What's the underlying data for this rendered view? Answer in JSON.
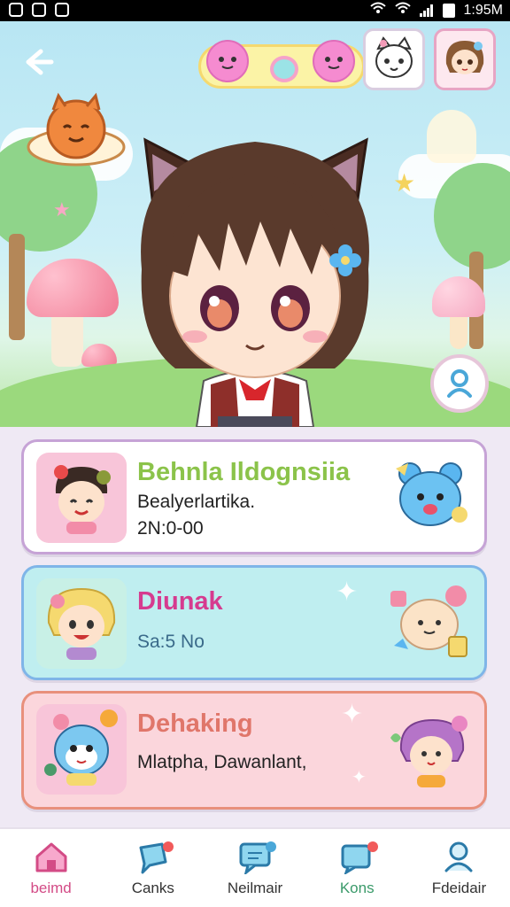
{
  "status_bar": {
    "time": "1:95M"
  },
  "header": {
    "back_icon": "back-arrow-icon",
    "profile_icons": [
      "cat-face-icon",
      "girl-avatar-icon"
    ]
  },
  "cards": [
    {
      "title": "Behnla Ildognsiia",
      "subtitle": "Bealyerlartika.",
      "value": "2N:0-00",
      "color": "#8bc34a",
      "mascot": "blue-bear-icon"
    },
    {
      "title": "Diunak",
      "subtitle": "Sa:5 No",
      "color": "#d63b8f",
      "mascot": "cream-cat-icon"
    },
    {
      "title": "Dehaking",
      "subtitle": "Mlatpha, Dawanlant,",
      "color": "#e0766a",
      "mascot": "purple-girl-icon"
    }
  ],
  "nav": [
    {
      "label": "beimd",
      "icon": "home-icon"
    },
    {
      "label": "Canks",
      "icon": "chat-icon"
    },
    {
      "label": "Neilmair",
      "icon": "message-icon"
    },
    {
      "label": "Kons",
      "icon": "notification-icon"
    },
    {
      "label": "Fdeidair",
      "icon": "profile-icon"
    }
  ],
  "colors": {
    "accent": "#d34b86",
    "card1_border": "#c6a3d6",
    "card2_border": "#7fb5e8",
    "card3_border": "#e8907c"
  }
}
